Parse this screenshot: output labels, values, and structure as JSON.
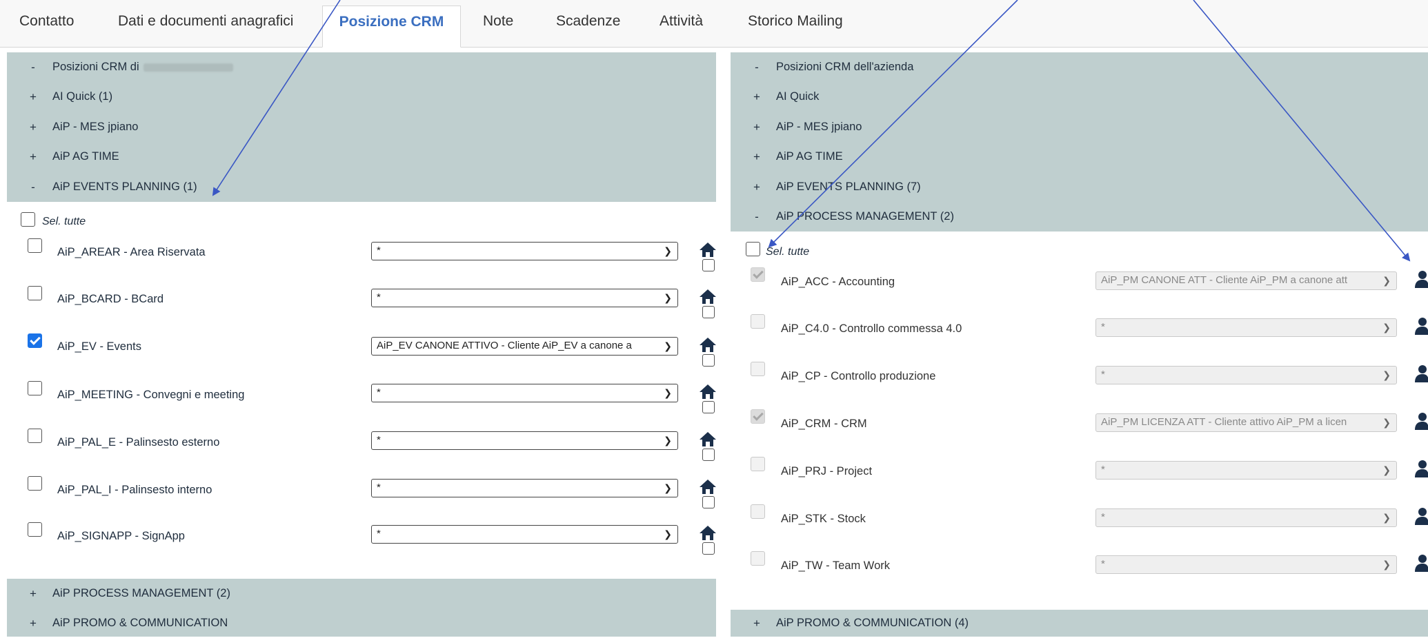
{
  "tabs": [
    {
      "label": "Contatto"
    },
    {
      "label": "Dati e documenti anagrafici"
    },
    {
      "label": "Posizione CRM"
    },
    {
      "label": "Note"
    },
    {
      "label": "Scadenze"
    },
    {
      "label": "Attività"
    },
    {
      "label": "Storico Mailing"
    }
  ],
  "left": {
    "groups_top": [
      {
        "sign": "-",
        "label": "Posizioni CRM di"
      },
      {
        "sign": "+",
        "label": "AI Quick (1)"
      },
      {
        "sign": "+",
        "label": "AiP - MES jpiano"
      },
      {
        "sign": "+",
        "label": "AiP AG TIME"
      },
      {
        "sign": "-",
        "label": "AiP EVENTS PLANNING (1)"
      }
    ],
    "select_all": "Sel. tutte",
    "products": [
      {
        "label": "AiP_AREAR - Area Riservata",
        "checked": false,
        "select": "*"
      },
      {
        "label": "AiP_BCARD - BCard",
        "checked": false,
        "select": "*"
      },
      {
        "label": "AiP_EV - Events",
        "checked": true,
        "select": "AiP_EV CANONE ATTIVO - Cliente AiP_EV a canone a"
      },
      {
        "label": "AiP_MEETING - Convegni e meeting",
        "checked": false,
        "select": "*"
      },
      {
        "label": "AiP_PAL_E - Palinsesto esterno",
        "checked": false,
        "select": "*"
      },
      {
        "label": "AiP_PAL_I - Palinsesto interno",
        "checked": false,
        "select": "*"
      },
      {
        "label": "AiP_SIGNAPP - SignApp",
        "checked": false,
        "select": "*"
      }
    ],
    "groups_bottom": [
      {
        "sign": "+",
        "label": "AiP PROCESS MANAGEMENT (2)"
      },
      {
        "sign": "+",
        "label": "AiP PROMO & COMMUNICATION"
      }
    ]
  },
  "right": {
    "groups_top": [
      {
        "sign": "-",
        "label": "Posizioni CRM dell'azienda"
      },
      {
        "sign": "+",
        "label": "AI Quick"
      },
      {
        "sign": "+",
        "label": "AiP - MES jpiano"
      },
      {
        "sign": "+",
        "label": "AiP AG TIME"
      },
      {
        "sign": "+",
        "label": "AiP EVENTS PLANNING (7)"
      },
      {
        "sign": "-",
        "label": "AiP PROCESS MANAGEMENT (2)"
      }
    ],
    "select_all": "Sel. tutte",
    "products": [
      {
        "label": "AiP_ACC - Accounting",
        "checked": true,
        "select": "AiP_PM CANONE ATT - Cliente AiP_PM a canone att"
      },
      {
        "label": "AiP_C4.0 - Controllo commessa 4.0",
        "checked": false,
        "select": "*"
      },
      {
        "label": "AiP_CP - Controllo produzione",
        "checked": false,
        "select": "*"
      },
      {
        "label": "AiP_CRM - CRM",
        "checked": true,
        "select": "AiP_PM LICENZA ATT - Cliente attivo AiP_PM a licen"
      },
      {
        "label": "AiP_PRJ - Project",
        "checked": false,
        "select": "*"
      },
      {
        "label": "AiP_STK - Stock",
        "checked": false,
        "select": "*"
      },
      {
        "label": "AiP_TW - Team Work",
        "checked": false,
        "select": "*"
      }
    ],
    "groups_bottom": [
      {
        "sign": "+",
        "label": "AiP PROMO & COMMUNICATION (4)"
      }
    ]
  },
  "colors": {
    "group_bg": "#bfcfcf",
    "active_tab": "#3b6fc0",
    "annotation_arrow": "#3a57c4",
    "checkbox_checked": "#1a73e8"
  },
  "icons": {
    "left_row_icon": "home-icon",
    "right_row_icon": "user-icon"
  }
}
